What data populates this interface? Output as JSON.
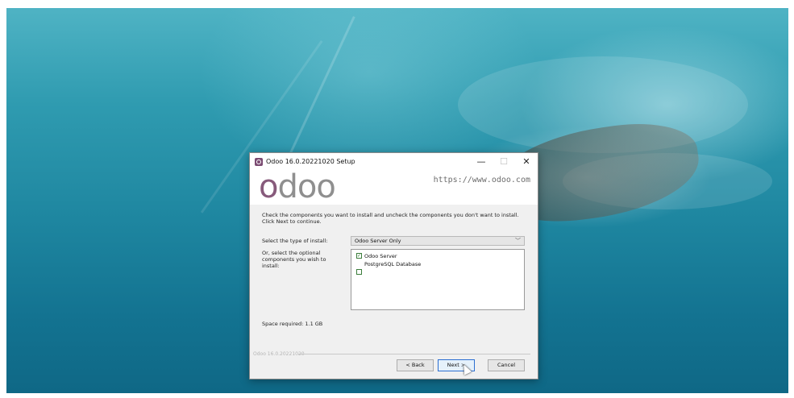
{
  "window": {
    "title": "Odoo 16.0.20221020 Setup",
    "controls": {
      "minimize": "—",
      "maximize": "☐",
      "close": "✕"
    }
  },
  "header": {
    "logo_first": "o",
    "logo_rest": "doo",
    "url": "https://www.odoo.com"
  },
  "description": "Check the components you want to install and uncheck the components you don't want to install. Click Next to continue.",
  "install_type": {
    "label": "Select the type of install:",
    "selected": "Odoo Server Only",
    "chevron": "﹀"
  },
  "components": {
    "label": "Or, select the optional components you wish to install:",
    "items": [
      {
        "label": "Odoo Server",
        "checked": true,
        "check_glyph": "✓"
      },
      {
        "label": "PostgreSQL Database",
        "checked": false,
        "check_glyph": ""
      },
      {
        "label": "",
        "checked": false,
        "check_glyph": ""
      }
    ]
  },
  "space_required": "Space required: 1.1 GB",
  "brand_footer": "Odoo 16.0.20221020",
  "buttons": {
    "back": "< Back",
    "next": "Next >",
    "cancel": "Cancel"
  },
  "colors": {
    "odoo_purple": "#875a7b",
    "logo_gray": "#8f8f8f"
  }
}
